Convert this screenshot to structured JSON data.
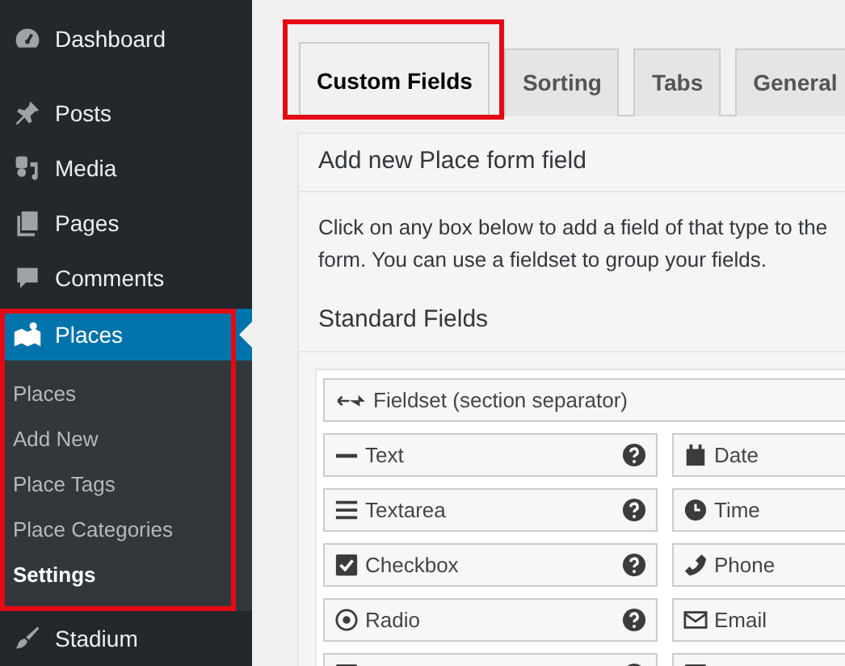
{
  "sidebar": {
    "items": [
      {
        "label": "Dashboard",
        "selected": false
      },
      {
        "label": "Posts",
        "selected": false
      },
      {
        "label": "Media",
        "selected": false
      },
      {
        "label": "Pages",
        "selected": false
      },
      {
        "label": "Comments",
        "selected": false
      },
      {
        "label": "Places",
        "selected": true,
        "highlighted": true,
        "children": [
          {
            "label": "Places",
            "selected": false
          },
          {
            "label": "Add New",
            "selected": false
          },
          {
            "label": "Place Tags",
            "selected": false
          },
          {
            "label": "Place Categories",
            "selected": false
          },
          {
            "label": "Settings",
            "selected": true
          }
        ]
      },
      {
        "label": "Stadium",
        "selected": false
      }
    ]
  },
  "tabs": [
    {
      "label": "Custom Fields",
      "selected": true,
      "highlighted": true
    },
    {
      "label": "Sorting",
      "selected": false,
      "highlighted": false
    },
    {
      "label": "Tabs",
      "selected": false,
      "highlighted": false
    },
    {
      "label": "General",
      "selected": false,
      "highlighted": false
    }
  ],
  "panel": {
    "title": "Add new Place form field",
    "description": "Click on any box below to add a field of that type to the form. You can use a fieldset to group your fields.",
    "section_title": "Standard Fields",
    "fieldset": "Fieldset (section separator)",
    "fields": [
      {
        "kind": "field",
        "label": "Text",
        "help": true
      },
      {
        "kind": "field",
        "label": "Date"
      },
      {
        "kind": "field",
        "label": "Textarea",
        "help": true
      },
      {
        "kind": "field",
        "label": "Time"
      },
      {
        "kind": "field",
        "label": "Checkbox",
        "help": true
      },
      {
        "kind": "field",
        "label": "Phone"
      },
      {
        "kind": "field",
        "label": "Radio",
        "help": true
      },
      {
        "kind": "field",
        "label": "Email"
      },
      {
        "kind": "field",
        "help": true
      },
      {
        "kind": "field"
      }
    ]
  }
}
